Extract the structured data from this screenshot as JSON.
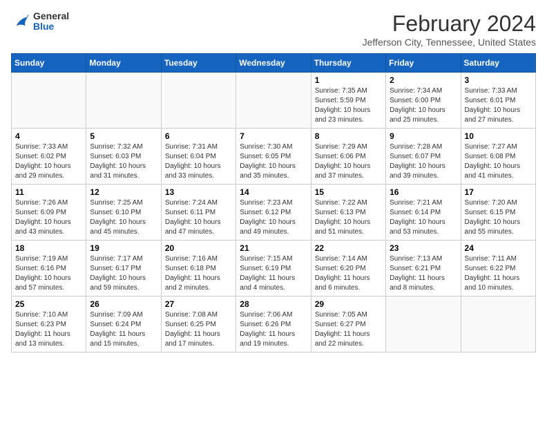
{
  "logo": {
    "general": "General",
    "blue": "Blue"
  },
  "header": {
    "month": "February 2024",
    "location": "Jefferson City, Tennessee, United States"
  },
  "weekdays": [
    "Sunday",
    "Monday",
    "Tuesday",
    "Wednesday",
    "Thursday",
    "Friday",
    "Saturday"
  ],
  "weeks": [
    [
      {
        "day": "",
        "empty": true
      },
      {
        "day": "",
        "empty": true
      },
      {
        "day": "",
        "empty": true
      },
      {
        "day": "",
        "empty": true
      },
      {
        "day": "1",
        "sunrise": "7:35 AM",
        "sunset": "5:59 PM",
        "daylight": "10 hours and 23 minutes."
      },
      {
        "day": "2",
        "sunrise": "7:34 AM",
        "sunset": "6:00 PM",
        "daylight": "10 hours and 25 minutes."
      },
      {
        "day": "3",
        "sunrise": "7:33 AM",
        "sunset": "6:01 PM",
        "daylight": "10 hours and 27 minutes."
      }
    ],
    [
      {
        "day": "4",
        "sunrise": "7:33 AM",
        "sunset": "6:02 PM",
        "daylight": "10 hours and 29 minutes."
      },
      {
        "day": "5",
        "sunrise": "7:32 AM",
        "sunset": "6:03 PM",
        "daylight": "10 hours and 31 minutes."
      },
      {
        "day": "6",
        "sunrise": "7:31 AM",
        "sunset": "6:04 PM",
        "daylight": "10 hours and 33 minutes."
      },
      {
        "day": "7",
        "sunrise": "7:30 AM",
        "sunset": "6:05 PM",
        "daylight": "10 hours and 35 minutes."
      },
      {
        "day": "8",
        "sunrise": "7:29 AM",
        "sunset": "6:06 PM",
        "daylight": "10 hours and 37 minutes."
      },
      {
        "day": "9",
        "sunrise": "7:28 AM",
        "sunset": "6:07 PM",
        "daylight": "10 hours and 39 minutes."
      },
      {
        "day": "10",
        "sunrise": "7:27 AM",
        "sunset": "6:08 PM",
        "daylight": "10 hours and 41 minutes."
      }
    ],
    [
      {
        "day": "11",
        "sunrise": "7:26 AM",
        "sunset": "6:09 PM",
        "daylight": "10 hours and 43 minutes."
      },
      {
        "day": "12",
        "sunrise": "7:25 AM",
        "sunset": "6:10 PM",
        "daylight": "10 hours and 45 minutes."
      },
      {
        "day": "13",
        "sunrise": "7:24 AM",
        "sunset": "6:11 PM",
        "daylight": "10 hours and 47 minutes."
      },
      {
        "day": "14",
        "sunrise": "7:23 AM",
        "sunset": "6:12 PM",
        "daylight": "10 hours and 49 minutes."
      },
      {
        "day": "15",
        "sunrise": "7:22 AM",
        "sunset": "6:13 PM",
        "daylight": "10 hours and 51 minutes."
      },
      {
        "day": "16",
        "sunrise": "7:21 AM",
        "sunset": "6:14 PM",
        "daylight": "10 hours and 53 minutes."
      },
      {
        "day": "17",
        "sunrise": "7:20 AM",
        "sunset": "6:15 PM",
        "daylight": "10 hours and 55 minutes."
      }
    ],
    [
      {
        "day": "18",
        "sunrise": "7:19 AM",
        "sunset": "6:16 PM",
        "daylight": "10 hours and 57 minutes."
      },
      {
        "day": "19",
        "sunrise": "7:17 AM",
        "sunset": "6:17 PM",
        "daylight": "10 hours and 59 minutes."
      },
      {
        "day": "20",
        "sunrise": "7:16 AM",
        "sunset": "6:18 PM",
        "daylight": "11 hours and 2 minutes."
      },
      {
        "day": "21",
        "sunrise": "7:15 AM",
        "sunset": "6:19 PM",
        "daylight": "11 hours and 4 minutes."
      },
      {
        "day": "22",
        "sunrise": "7:14 AM",
        "sunset": "6:20 PM",
        "daylight": "11 hours and 6 minutes."
      },
      {
        "day": "23",
        "sunrise": "7:13 AM",
        "sunset": "6:21 PM",
        "daylight": "11 hours and 8 minutes."
      },
      {
        "day": "24",
        "sunrise": "7:11 AM",
        "sunset": "6:22 PM",
        "daylight": "11 hours and 10 minutes."
      }
    ],
    [
      {
        "day": "25",
        "sunrise": "7:10 AM",
        "sunset": "6:23 PM",
        "daylight": "11 hours and 13 minutes."
      },
      {
        "day": "26",
        "sunrise": "7:09 AM",
        "sunset": "6:24 PM",
        "daylight": "11 hours and 15 minutes."
      },
      {
        "day": "27",
        "sunrise": "7:08 AM",
        "sunset": "6:25 PM",
        "daylight": "11 hours and 17 minutes."
      },
      {
        "day": "28",
        "sunrise": "7:06 AM",
        "sunset": "6:26 PM",
        "daylight": "11 hours and 19 minutes."
      },
      {
        "day": "29",
        "sunrise": "7:05 AM",
        "sunset": "6:27 PM",
        "daylight": "11 hours and 22 minutes."
      },
      {
        "day": "",
        "empty": true
      },
      {
        "day": "",
        "empty": true
      }
    ]
  ]
}
